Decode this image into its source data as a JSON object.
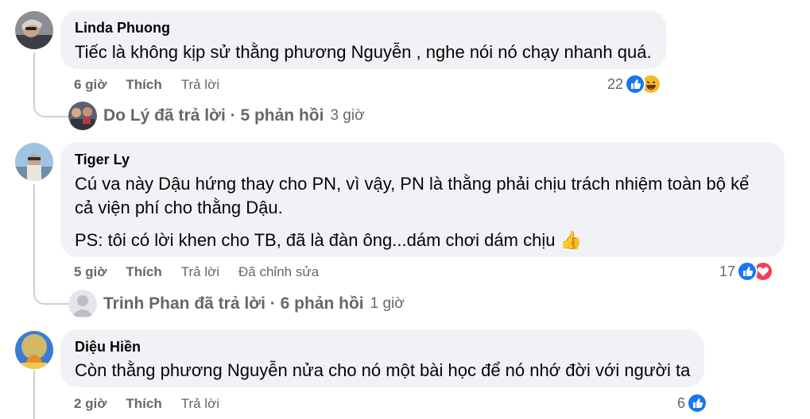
{
  "comments": [
    {
      "author": "Linda Phuong",
      "text": "Tiếc là không kịp sử thằng phương Nguyễn , nghe nói nó chạy nhanh quá.",
      "time": "6 giờ",
      "like": "Thích",
      "reply": "Trả lời",
      "reaction_count": "22",
      "reactions": [
        "like-icon",
        "haha-icon"
      ],
      "replies_summary": "Do Lý đã trả lời · 5 phản hồi",
      "replies_time": "3 giờ"
    },
    {
      "author": "Tiger Ly",
      "text_line1": "Cú va này Dậu hứng thay cho PN, vì vậy, PN là thằng phải chịu trách nhiệm toàn bộ kể",
      "text_line2": "cả viện phí cho thằng Dậu.",
      "text_ps": "PS: tôi có lời khen cho TB, đã là đàn ông...dám chơi dám chịu 👍",
      "time": "5 giờ",
      "like": "Thích",
      "reply": "Trả lời",
      "edited": "Đã chỉnh sửa",
      "reaction_count": "17",
      "reactions": [
        "like-icon",
        "love-icon"
      ],
      "replies_summary": "Trinh Phan đã trả lời · 6 phản hồi",
      "replies_time": "1 giờ"
    },
    {
      "author": "Diệu Hiền",
      "text": "Còn thằng phương Nguyễn nửa cho nó một bài học để nó nhớ đời với người ta",
      "time": "2 giờ",
      "like": "Thích",
      "reply": "Trả lời",
      "reaction_count": "6",
      "reactions": [
        "like-icon"
      ]
    }
  ],
  "colors": {
    "bubble": "#f0f2f5",
    "muted": "#65676b",
    "like_blue": "#1877f2",
    "love_red": "#f33e58",
    "haha_yellow": "#f7b928"
  }
}
